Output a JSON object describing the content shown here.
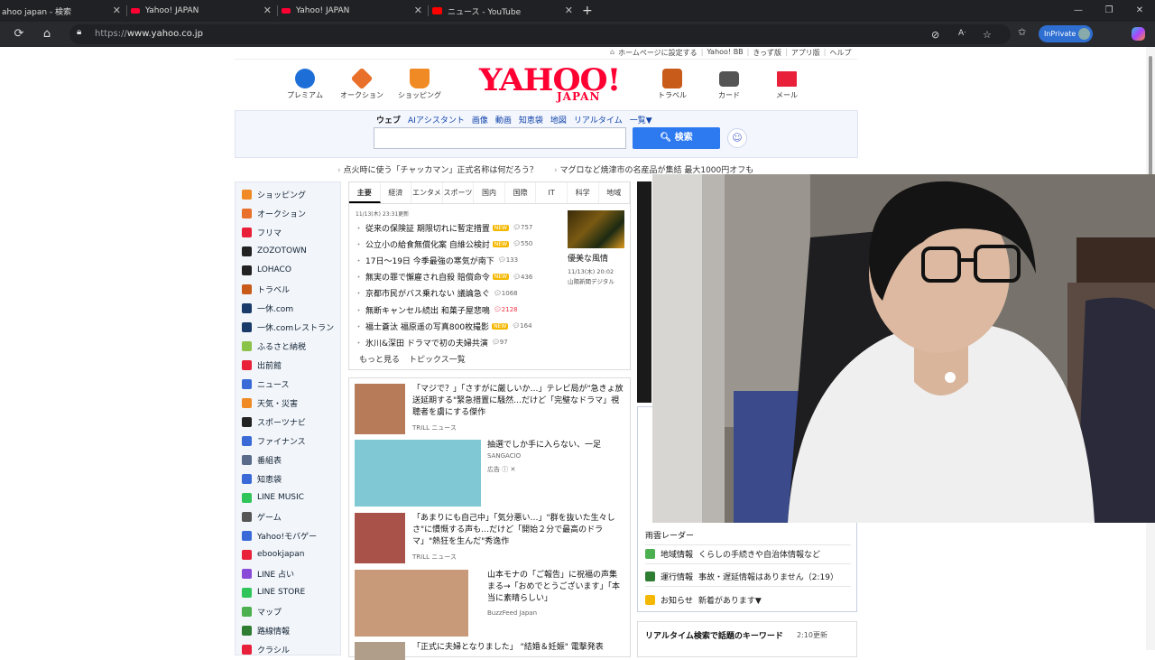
{
  "browser": {
    "tabs": [
      {
        "title": "ahoo japan - 検索",
        "fav_color": "#1a73e8"
      },
      {
        "title": "Yahoo! JAPAN",
        "fav_color": "#ff0033"
      },
      {
        "title": "Yahoo! JAPAN",
        "fav_color": "#ff0033"
      },
      {
        "title": "ニュース - YouTube",
        "fav_color": "#ff0000"
      }
    ],
    "new_tab": "+",
    "url_prefix": "https://",
    "url_host": "www.yahoo.co.jp",
    "inprivate": "InPrivate"
  },
  "header": {
    "top_links": [
      "ホームページに設定する",
      "Yahoo! BB",
      "きっず版",
      "アプリ版",
      "ヘルプ"
    ],
    "services_left": [
      {
        "label": "プレミアム",
        "color": "#1e6ed8"
      },
      {
        "label": "オークション",
        "color": "#e8702a"
      },
      {
        "label": "ショッピング",
        "color": "#f08a24"
      }
    ],
    "services_right": [
      {
        "label": "トラベル",
        "color": "#c85a1a"
      },
      {
        "label": "カード",
        "color": "#555555"
      },
      {
        "label": "メール",
        "color": "#e8203a"
      }
    ],
    "logo_main": "YAHOO!",
    "logo_sub": "JAPAN"
  },
  "search": {
    "tabs": [
      "ウェブ",
      "AIアシスタント",
      "画像",
      "動画",
      "知恵袋",
      "地図",
      "リアルタイム",
      "一覧▼"
    ],
    "button": "検索",
    "ai_icon": "assistant-icon"
  },
  "promos": [
    "点火時に使う「チャッカマン」正式名称は何だろう？",
    "マグロなど焼津市の名産品が集結 最大1000円オフも"
  ],
  "sidebar": [
    {
      "label": "ショッピング",
      "color": "#f08a24"
    },
    {
      "label": "オークション",
      "color": "#e8702a"
    },
    {
      "label": "フリマ",
      "color": "#e8203a"
    },
    {
      "label": "ZOZOTOWN",
      "color": "#222222"
    },
    {
      "label": "LOHACO",
      "color": "#222222"
    },
    {
      "label": "トラベル",
      "color": "#c85a1a"
    },
    {
      "label": "一休.com",
      "color": "#1a3a6a"
    },
    {
      "label": "一休.comレストラン",
      "color": "#1a3a6a"
    },
    {
      "label": "ふるさと納税",
      "color": "#8bc34a"
    },
    {
      "label": "出前館",
      "color": "#e8203a"
    },
    {
      "label": "ニュース",
      "color": "#3a6ad8"
    },
    {
      "label": "天気・災害",
      "color": "#f08a24"
    },
    {
      "label": "スポーツナビ",
      "color": "#222222"
    },
    {
      "label": "ファイナンス",
      "color": "#3a6ad8"
    },
    {
      "label": "番組表",
      "color": "#5a6a8a"
    },
    {
      "label": "知恵袋",
      "color": "#3a6ad8"
    },
    {
      "label": "LINE MUSIC",
      "color": "#2fc55a"
    },
    {
      "label": "ゲーム",
      "color": "#555555"
    },
    {
      "label": "Yahoo!モバゲー",
      "color": "#3a6ad8"
    },
    {
      "label": "ebookjapan",
      "color": "#e8203a"
    },
    {
      "label": "LINE 占い",
      "color": "#8a4ad8"
    },
    {
      "label": "LINE STORE",
      "color": "#2fc55a"
    },
    {
      "label": "マップ",
      "color": "#4caf50"
    },
    {
      "label": "路線情報",
      "color": "#2e7d32"
    },
    {
      "label": "クラシル",
      "color": "#e8203a"
    }
  ],
  "news": {
    "tabs": [
      "主要",
      "経済",
      "エンタメ",
      "スポーツ",
      "国内",
      "国際",
      "IT",
      "科学",
      "地域"
    ],
    "updated": "11/13(木) 23:31更新",
    "items": [
      {
        "text": "従来の保険証 期限切れに暫定措置",
        "new": "NEW",
        "comments": "757",
        "hot": false
      },
      {
        "text": "公立小の給食無償化案 自維公検討",
        "new": "NEW",
        "comments": "550",
        "hot": false
      },
      {
        "text": "17日～19日 今季最強の寒気が南下",
        "new": "",
        "comments": "133",
        "hot": false
      },
      {
        "text": "無実の罪で懈雇され自殺 賠償命令",
        "new": "NEW",
        "comments": "436",
        "hot": false
      },
      {
        "text": "京都市民がバス乗れない 議論急ぐ",
        "new": "",
        "comments": "1068",
        "hot": false
      },
      {
        "text": "無断キャンセル続出 和菓子屋悲鳴",
        "new": "",
        "comments": "2128",
        "hot": true
      },
      {
        "text": "福士蒼汰 福原遥の写真800枚撮影",
        "new": "NEW",
        "comments": "164",
        "hot": false
      },
      {
        "text": "氷川&深田 ドラマで初の夫婦共演",
        "new": "",
        "comments": "97",
        "hot": false
      }
    ],
    "photo_caption": "優美な風情",
    "photo_date": "11/13(木) 20:02",
    "photo_source": "山陽新聞デジタル",
    "more": "もっと見る",
    "topics": "トピックス一覧"
  },
  "feed": [
    {
      "title": "「マジで？」「さすがに厳しいか…」テレビ局が\"急きょ放送延期する\"緊急措置に騒然…だけど「完璧なドラマ」視聴者を虜にする傑作",
      "source": "TRILL ニュース",
      "ad": ""
    },
    {
      "title": "抽選でしか手に入らない、一足",
      "source": "SANGACIO",
      "ad": "広告"
    },
    {
      "title": "「あまりにも自己中」「気分悪い…」\"群を抜いた生々しさ\"に慣慨する声も…だけど「開始２分で最高のドラマ」\"熱狂を生んだ\"秀逸作",
      "source": "TRILL ニュース",
      "ad": ""
    },
    {
      "title": "山本モナの「ご報告」に祝福の声集まる→「おめでとうございます」「本当に素晴らしい」",
      "source": "BuzzFeed Japan",
      "ad": ""
    },
    {
      "title": "「正式に夫婦となりました」 \"結婚＆妊娠\" 電撃発表",
      "source": "",
      "ad": ""
    }
  ],
  "local": [
    {
      "label": "雨雲レーダー",
      "text": ""
    },
    {
      "label": "地域情報",
      "text": "くらしの手続きや自治体情報など"
    },
    {
      "label": "運行情報",
      "text": "事故・遅延情報はありません（2:19）"
    },
    {
      "label": "お知らせ",
      "text": "新着があります▼"
    }
  ],
  "realtime": {
    "title": "リアルタイム検索で話題のキーワード",
    "updated": "2:10更新"
  }
}
